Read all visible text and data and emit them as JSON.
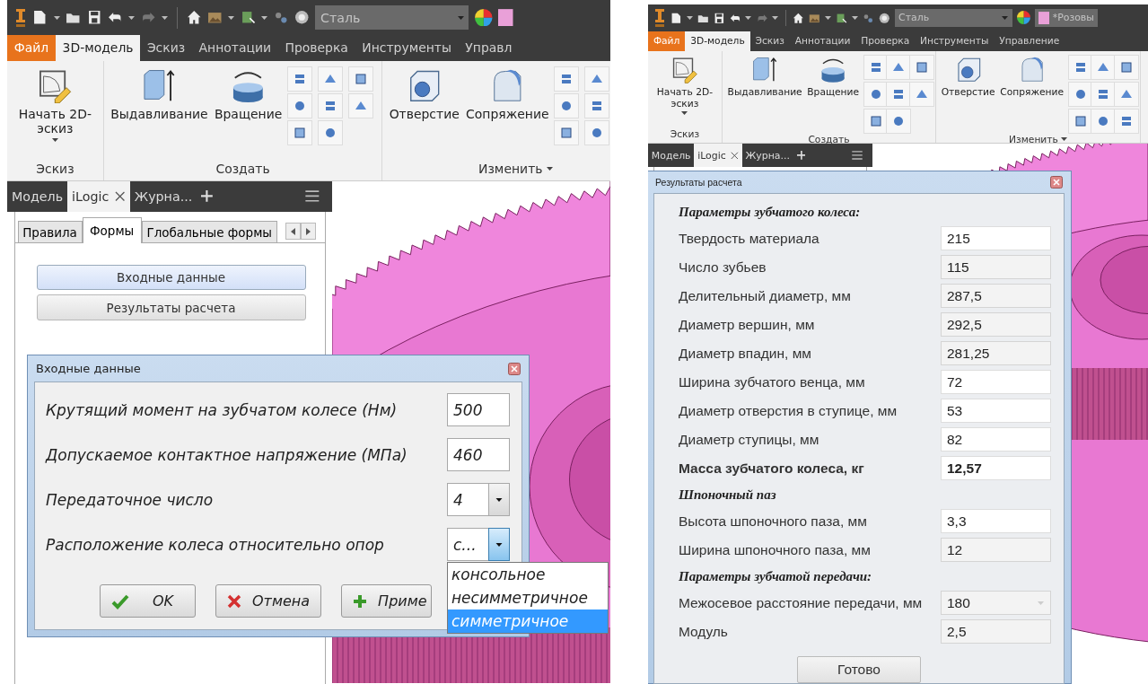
{
  "screens": [
    {
      "quick_access": {
        "material": "Сталь"
      },
      "ribbon": {
        "file_tab": "Файл",
        "tabs": [
          {
            "label": "3D-модель",
            "selected": true
          },
          {
            "label": "Эскиз",
            "selected": false
          },
          {
            "label": "Аннотации",
            "selected": false
          },
          {
            "label": "Проверка",
            "selected": false
          },
          {
            "label": "Инструменты",
            "selected": false
          },
          {
            "label": "Управл",
            "selected": false
          }
        ],
        "groups": [
          {
            "kind": "sketch",
            "title": "Эскиз",
            "has_menu": false,
            "tools": [
              {
                "label": "Начать 2D-эскиз",
                "dropdown": true
              }
            ]
          },
          {
            "kind": "create",
            "title": "Создать",
            "has_menu": false,
            "tools": [
              {
                "label": "Выдавливание",
                "dropdown": false
              },
              {
                "label": "Вращение",
                "dropdown": false
              }
            ]
          },
          {
            "kind": "modify",
            "title": "Изменить",
            "has_menu": true,
            "tools": [
              {
                "label": "Отверстие",
                "dropdown": false
              },
              {
                "label": "Сопряжение",
                "dropdown": false
              }
            ]
          }
        ]
      },
      "browser": {
        "tabs": [
          {
            "label": "Модель",
            "selected": false,
            "closable": false
          },
          {
            "label": "iLogic",
            "selected": true,
            "closable": true
          },
          {
            "label": "Журна...",
            "selected": false,
            "closable": false
          }
        ],
        "form_tabs": [
          {
            "label": "Правила",
            "selected": false
          },
          {
            "label": "Формы",
            "selected": true
          },
          {
            "label": "Глобальные формы",
            "selected": false
          }
        ],
        "form_buttons": [
          {
            "label": "Входные данные",
            "hovered": true
          },
          {
            "label": "Результаты расчета",
            "hovered": false
          }
        ]
      },
      "dialog": {
        "kind": "form",
        "title": "Входные данные",
        "rows": [
          {
            "kind": "text",
            "label": "Крутящий момент на зубчатом колесе (Нм)",
            "value": "500"
          },
          {
            "kind": "text",
            "label": "Допускаемое контактное напряжение (МПа)",
            "value": "460"
          },
          {
            "kind": "combo",
            "label": "Передаточное число",
            "value": "4",
            "open": false
          },
          {
            "kind": "combo",
            "label": "Расположение колеса относительно опор",
            "value": "с...",
            "open": true,
            "options": [
              {
                "label": "консольное",
                "selected": false
              },
              {
                "label": "несимметричное",
                "selected": false
              },
              {
                "label": "симметричное",
                "selected": true
              }
            ]
          }
        ],
        "buttons": [
          {
            "kind": "ok",
            "label": "OK"
          },
          {
            "kind": "cancel",
            "label": "Отмена"
          },
          {
            "kind": "apply",
            "label": "Приме"
          }
        ]
      }
    },
    {
      "quick_access": {
        "material": "Сталь",
        "document": "*Розовы"
      },
      "ribbon": {
        "file_tab": "Файл",
        "tabs": [
          {
            "label": "3D-модель",
            "selected": true
          },
          {
            "label": "Эскиз",
            "selected": false
          },
          {
            "label": "Аннотации",
            "selected": false
          },
          {
            "label": "Проверка",
            "selected": false
          },
          {
            "label": "Инструменты",
            "selected": false
          },
          {
            "label": "Управление",
            "selected": false
          }
        ],
        "groups": [
          {
            "kind": "sketch",
            "title": "Эскиз",
            "has_menu": false,
            "tools": [
              {
                "label": "Начать 2D-эскиз",
                "dropdown": true
              }
            ]
          },
          {
            "kind": "create",
            "title": "Создать",
            "has_menu": false,
            "tools": [
              {
                "label": "Выдавливание",
                "dropdown": false
              },
              {
                "label": "Вращение",
                "dropdown": false
              }
            ]
          },
          {
            "kind": "modify",
            "title": "Изменить",
            "has_menu": true,
            "tools": [
              {
                "label": "Отверстие",
                "dropdown": false
              },
              {
                "label": "Сопряжение",
                "dropdown": false
              }
            ]
          }
        ]
      },
      "browser": {
        "tabs": [
          {
            "label": "Модель",
            "selected": false,
            "closable": false
          },
          {
            "label": "iLogic",
            "selected": true,
            "closable": true
          },
          {
            "label": "Журна...",
            "selected": false,
            "closable": false
          }
        ]
      },
      "dialog": {
        "kind": "results",
        "title": "Результаты расчета",
        "rows": [
          {
            "kind": "heading",
            "label": "Параметры зубчатого колеса:"
          },
          {
            "kind": "field",
            "label": "Твердость материала",
            "value": "215",
            "readonly": false,
            "bold": false
          },
          {
            "kind": "field",
            "label": "Число зубьев",
            "value": "115",
            "readonly": true,
            "bold": false
          },
          {
            "kind": "field",
            "label": "Делительный диаметр, мм",
            "value": "287,5",
            "readonly": true,
            "bold": false
          },
          {
            "kind": "field",
            "label": "Диаметр вершин, мм",
            "value": "292,5",
            "readonly": true,
            "bold": false
          },
          {
            "kind": "field",
            "label": "Диаметр впадин, мм",
            "value": "281,25",
            "readonly": true,
            "bold": false
          },
          {
            "kind": "field",
            "label": "Ширина зубчатого венца, мм",
            "value": "72",
            "readonly": false,
            "bold": false
          },
          {
            "kind": "field",
            "label": "Диаметр отверстия в ступице, мм",
            "value": "53",
            "readonly": false,
            "bold": false
          },
          {
            "kind": "field",
            "label": "Диаметр ступицы, мм",
            "value": "82",
            "readonly": false,
            "bold": false
          },
          {
            "kind": "field",
            "label": "Масса зубчатого колеса, кг",
            "value": "12,57",
            "readonly": false,
            "bold": true
          },
          {
            "kind": "heading",
            "label": "Шпоночный паз"
          },
          {
            "kind": "field",
            "label": "Высота шпоночного паза, мм",
            "value": "3,3",
            "readonly": false,
            "bold": false
          },
          {
            "kind": "field",
            "label": "Ширина шпоночного паза, мм",
            "value": "12",
            "readonly": true,
            "bold": false
          },
          {
            "kind": "heading",
            "label": "Параметры зубчатой передачи:"
          },
          {
            "kind": "combo",
            "label": "Межосевое расстояние передачи, мм",
            "value": "180",
            "readonly": true,
            "bold": false
          },
          {
            "kind": "field",
            "label": "Модуль",
            "value": "2,5",
            "readonly": true,
            "bold": false
          }
        ],
        "buttons": [
          {
            "kind": "done",
            "label": "Готово"
          }
        ]
      }
    }
  ]
}
